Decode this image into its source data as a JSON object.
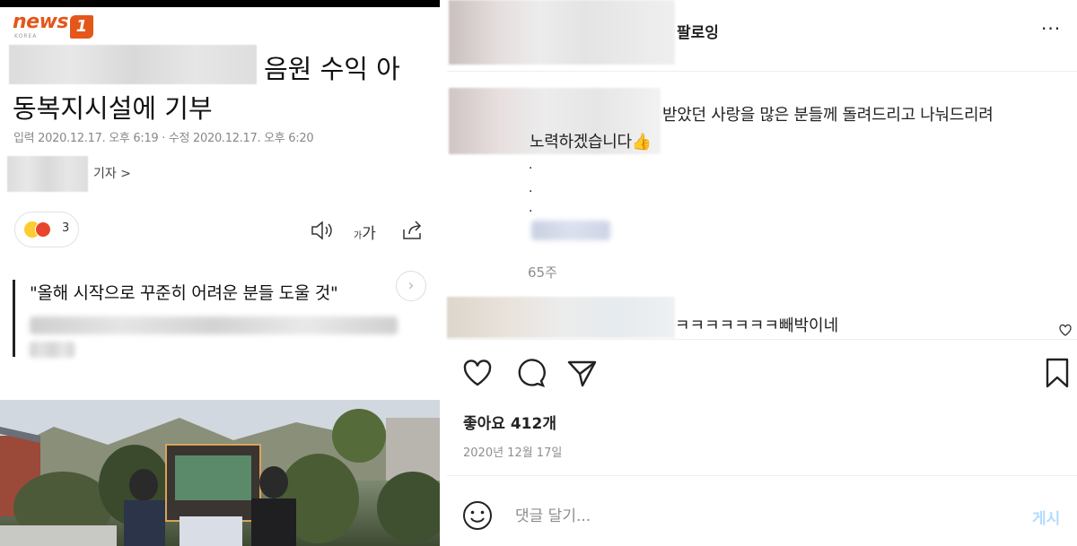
{
  "news": {
    "logo_text": "news",
    "logo_badge": "1",
    "logo_sub": "KOREA",
    "headline_line1": "음원 수익 아",
    "headline_line2": "동복지시설에 기부",
    "meta": "입력 2020.12.17. 오후 6:19 · 수정 2020.12.17. 오후 6:20",
    "reporter_label": "기자 >",
    "reaction_count": "3",
    "font_size_label": "가",
    "font_size_small": "가",
    "quote": "\"올해 시작으로 꾸준히 어려운 분들 도울 것\"",
    "next_arrow": "›"
  },
  "instagram": {
    "follow_label": "팔로잉",
    "more_label": "···",
    "comment1_text_line1": "받았던 사랑을 많은 분들께 돌려드리고 나눠드리려",
    "comment1_text_line2": "노력하겠습니다👍",
    "comment1_dot1": ".",
    "comment1_dot2": ".",
    "comment1_dot3": ".",
    "comment1_time": "65주",
    "comment2_text": "ㅋㅋㅋㅋㅋㅋㅋ빼박이네",
    "likes": "좋아요 412개",
    "date": "2020년 12월 17일",
    "add_comment_placeholder": "댓글 달기...",
    "post_label": "게시"
  },
  "colors": {
    "news_brand": "#e5561a",
    "post_button": "#b3dbff",
    "muted": "#8e8e8e"
  }
}
